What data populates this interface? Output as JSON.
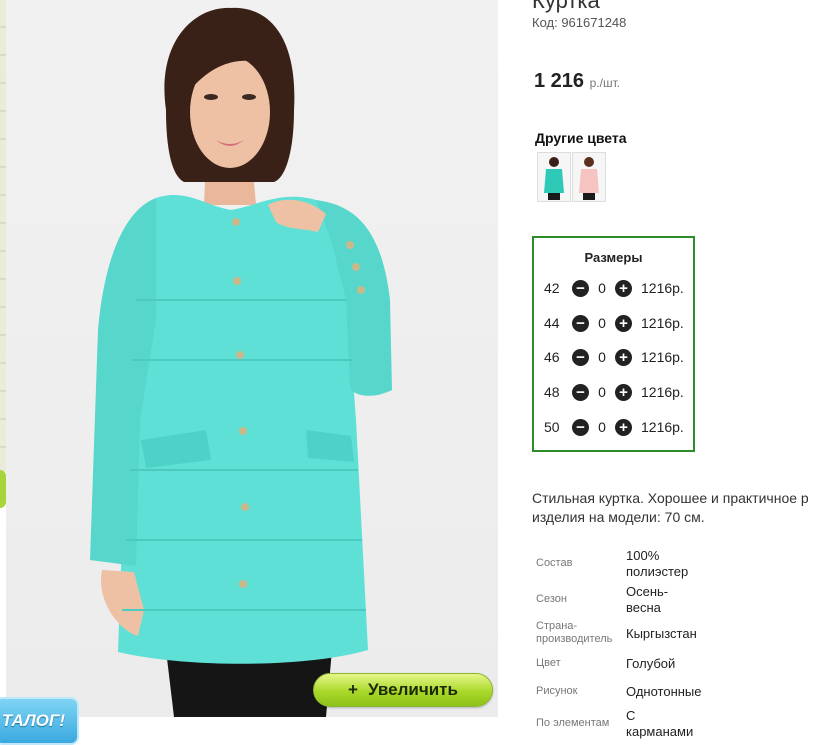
{
  "product": {
    "title": "Куртка",
    "code": "Код: 961671248",
    "price": "1 216",
    "price_unit": "р./шт."
  },
  "colors": {
    "title": "Другие цвета",
    "swatches": [
      {
        "name": "turquoise",
        "color": "#2fc9b8"
      },
      {
        "name": "pink",
        "color": "#f5c4c0"
      }
    ]
  },
  "sizes": {
    "title": "Размеры",
    "rows": [
      {
        "size": "42",
        "qty": "0",
        "price": "1216р."
      },
      {
        "size": "44",
        "qty": "0",
        "price": "1216р."
      },
      {
        "size": "46",
        "qty": "0",
        "price": "1216р."
      },
      {
        "size": "48",
        "qty": "0",
        "price": "1216р."
      },
      {
        "size": "50",
        "qty": "0",
        "price": "1216р."
      }
    ]
  },
  "description": {
    "line1": "Стильная куртка. Хорошее и практичное р",
    "line2": "изделия на модели: 70 см."
  },
  "attributes": [
    {
      "label": "Состав",
      "value": "100% полиэстер"
    },
    {
      "label": "Сезон",
      "value": "Осень-весна"
    },
    {
      "label": "Страна-производитель",
      "value": "Кыргызстан"
    },
    {
      "label": "Цвет",
      "value": "Голубой"
    },
    {
      "label": "Рисунок",
      "value": "Однотонные"
    },
    {
      "label": "По элементам",
      "value": "С карманами"
    }
  ],
  "zoom_button": {
    "icon": "plus-icon",
    "label": "Увеличить"
  },
  "catalog_badge": "ТАЛОГ!",
  "colors_palette": {
    "accent_green": "#2e8b2a",
    "jacket": "#5fe0d6",
    "button_green": "#a9d829"
  }
}
